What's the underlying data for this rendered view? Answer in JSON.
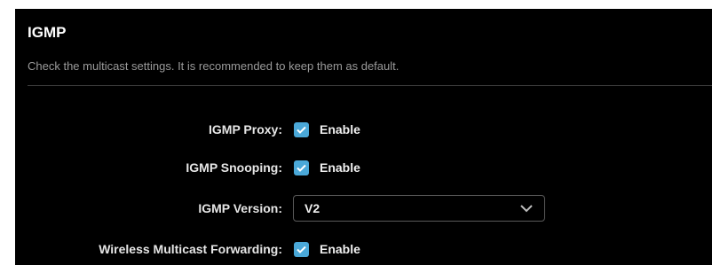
{
  "section": {
    "title": "IGMP",
    "description": "Check the multicast settings. It is recommended to keep them as default."
  },
  "settings": {
    "igmp_proxy": {
      "label": "IGMP Proxy:",
      "option_label": "Enable",
      "checked": true
    },
    "igmp_snooping": {
      "label": "IGMP Snooping:",
      "option_label": "Enable",
      "checked": true
    },
    "igmp_version": {
      "label": "IGMP Version:",
      "selected": "V2"
    },
    "wireless_multicast_forwarding": {
      "label": "Wireless Multicast Forwarding:",
      "option_label": "Enable",
      "checked": true
    }
  },
  "colors": {
    "background": "#000000",
    "accent": "#4aa8d8",
    "muted_text": "#9a9a9a"
  },
  "icons": {
    "checkbox": "checkmark-icon",
    "dropdown": "chevron-down-icon"
  }
}
